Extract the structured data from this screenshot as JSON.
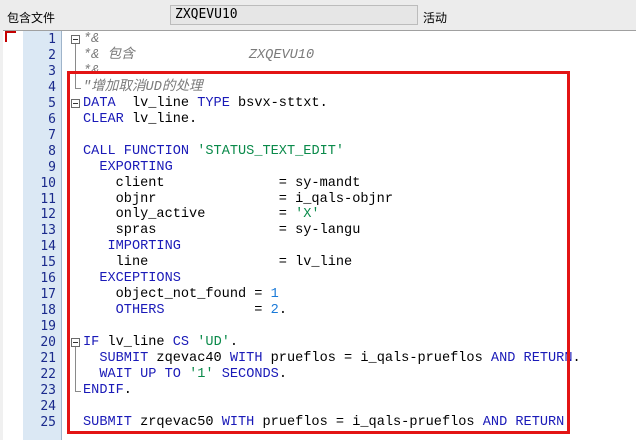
{
  "header": {
    "include_label": "包含文件",
    "include_value": "ZXQEVU10",
    "status": "活动"
  },
  "colors": {
    "keyword": "#1a1ab8",
    "string": "#0a8a4a",
    "number": "#1a7ad8",
    "comment": "#7a7a7a",
    "highlight_border": "#e31414"
  },
  "editor": {
    "lines": [
      {
        "num": "1",
        "tokens": [
          {
            "t": "*&",
            "c": "cmt"
          }
        ]
      },
      {
        "num": "2",
        "tokens": [
          {
            "t": "*& 包含              ZXQEVU10",
            "c": "cmt"
          }
        ]
      },
      {
        "num": "3",
        "tokens": [
          {
            "t": "*&",
            "c": "cmt"
          }
        ]
      },
      {
        "num": "4",
        "tokens": [
          {
            "t": "\"增加取消UD的处理",
            "c": "cmt"
          }
        ]
      },
      {
        "num": "5",
        "tokens": [
          {
            "t": "DATA",
            "c": "kw"
          },
          {
            "t": "  lv_line "
          },
          {
            "t": "TYPE",
            "c": "kw"
          },
          {
            "t": " bsvx-sttxt."
          }
        ]
      },
      {
        "num": "6",
        "tokens": [
          {
            "t": "CLEAR",
            "c": "kw"
          },
          {
            "t": " lv_line."
          }
        ]
      },
      {
        "num": "7",
        "tokens": []
      },
      {
        "num": "8",
        "tokens": [
          {
            "t": "CALL FUNCTION",
            "c": "kw"
          },
          {
            "t": " "
          },
          {
            "t": "'STATUS_TEXT_EDIT'",
            "c": "str"
          }
        ]
      },
      {
        "num": "9",
        "tokens": [
          {
            "t": "  EXPORTING",
            "c": "kw"
          }
        ]
      },
      {
        "num": "10",
        "tokens": [
          {
            "t": "    client              = sy-mandt"
          }
        ]
      },
      {
        "num": "11",
        "tokens": [
          {
            "t": "    objnr               = i_qals-objnr"
          }
        ]
      },
      {
        "num": "12",
        "tokens": [
          {
            "t": "    only_active         = "
          },
          {
            "t": "'X'",
            "c": "str"
          }
        ]
      },
      {
        "num": "13",
        "tokens": [
          {
            "t": "    spras               = sy-langu"
          }
        ]
      },
      {
        "num": "14",
        "tokens": [
          {
            "t": "   IMPORTING",
            "c": "kw"
          }
        ]
      },
      {
        "num": "15",
        "tokens": [
          {
            "t": "    line                = lv_line"
          }
        ]
      },
      {
        "num": "16",
        "tokens": [
          {
            "t": "  EXCEPTIONS",
            "c": "kw"
          }
        ]
      },
      {
        "num": "17",
        "tokens": [
          {
            "t": "    object_not_found = "
          },
          {
            "t": "1",
            "c": "num"
          }
        ]
      },
      {
        "num": "18",
        "tokens": [
          {
            "t": "    OTHERS",
            "c": "kw"
          },
          {
            "t": "           = "
          },
          {
            "t": "2",
            "c": "num"
          },
          {
            "t": "."
          }
        ]
      },
      {
        "num": "19",
        "tokens": []
      },
      {
        "num": "20",
        "tokens": [
          {
            "t": "IF",
            "c": "kw"
          },
          {
            "t": " lv_line "
          },
          {
            "t": "CS",
            "c": "kw"
          },
          {
            "t": " "
          },
          {
            "t": "'UD'",
            "c": "str"
          },
          {
            "t": "."
          }
        ]
      },
      {
        "num": "21",
        "tokens": [
          {
            "t": "  SUBMIT",
            "c": "kw"
          },
          {
            "t": " zqevac40 "
          },
          {
            "t": "WITH",
            "c": "kw"
          },
          {
            "t": " prueflos = i_qals-prueflos "
          },
          {
            "t": "AND RETURN",
            "c": "kw"
          },
          {
            "t": "."
          }
        ]
      },
      {
        "num": "22",
        "tokens": [
          {
            "t": "  WAIT UP TO",
            "c": "kw"
          },
          {
            "t": " "
          },
          {
            "t": "'1'",
            "c": "str"
          },
          {
            "t": " "
          },
          {
            "t": "SECONDS",
            "c": "kw"
          },
          {
            "t": "."
          }
        ]
      },
      {
        "num": "23",
        "tokens": [
          {
            "t": "ENDIF",
            "c": "kw"
          },
          {
            "t": "."
          }
        ]
      },
      {
        "num": "24",
        "tokens": []
      },
      {
        "num": "25",
        "tokens": [
          {
            "t": "SUBMIT",
            "c": "kw"
          },
          {
            "t": " zrqevac50 "
          },
          {
            "t": "WITH",
            "c": "kw"
          },
          {
            "t": " prueflos = i_qals-prueflos "
          },
          {
            "t": "AND RETURN",
            "c": "kw"
          },
          {
            "t": "."
          }
        ]
      }
    ]
  }
}
